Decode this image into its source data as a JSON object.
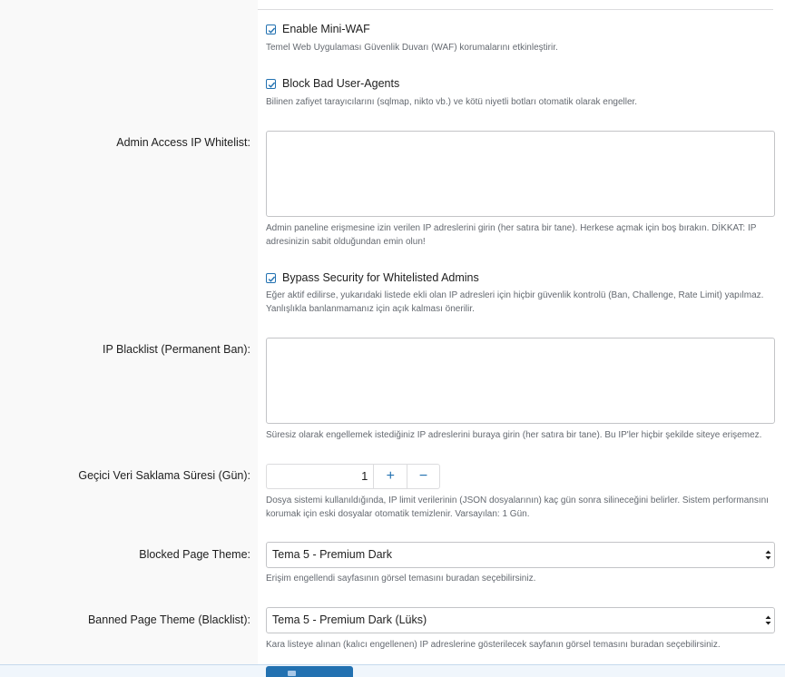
{
  "waf": {
    "label": "Enable Mini-WAF",
    "checked": true,
    "description": "Temel Web Uygulaması Güvenlik Duvarı (WAF) korumalarını etkinleştirir."
  },
  "bad_agents": {
    "label": "Block Bad User-Agents",
    "checked": true,
    "description": "Bilinen zafiyet tarayıcılarını (sqlmap, nikto vb.) ve kötü niyetli botları otomatik olarak engeller."
  },
  "whitelist": {
    "label": "Admin Access IP Whitelist:",
    "value": "",
    "description": "Admin paneline erişmesine izin verilen IP adreslerini girin (her satıra bir tane). Herkese açmak için boş bırakın. DİKKAT: IP adresinizin sabit olduğundan emin olun!"
  },
  "bypass": {
    "label": "Bypass Security for Whitelisted Admins",
    "checked": true,
    "description": "Eğer aktif edilirse, yukarıdaki listede ekli olan IP adresleri için hiçbir güvenlik kontrolü (Ban, Challenge, Rate Limit) yapılmaz. Yanlışlıkla banlanmamanız için açık kalması önerilir."
  },
  "blacklist": {
    "label": "IP Blacklist (Permanent Ban):",
    "value": "",
    "description": "Süresiz olarak engellemek istediğiniz IP adreslerini buraya girin (her satıra bir tane). Bu IP'ler hiçbir şekilde siteye erişemez."
  },
  "retention": {
    "label": "Geçici Veri Saklama Süresi (Gün):",
    "value": "1",
    "plus": "+",
    "minus": "−",
    "description": "Dosya sistemi kullanıldığında, IP limit verilerinin (JSON dosyalarının) kaç gün sonra silineceğini belirler. Sistem performansını korumak için eski dosyalar otomatik temizlenir. Varsayılan: 1 Gün."
  },
  "blocked_theme": {
    "label": "Blocked Page Theme:",
    "selected": "Tema 5 - Premium Dark",
    "description": "Erişim engellendi sayfasının görsel temasını buradan seçebilirsiniz."
  },
  "banned_theme": {
    "label": "Banned Page Theme (Blacklist):",
    "selected": "Tema 5 - Premium Dark (Lüks)",
    "description": "Kara listeye alınan (kalıcı engellenen) IP adreslerine gösterilecek sayfanın görsel temasını buradan seçebilirsiniz."
  },
  "colors": {
    "accent": "#2271b1",
    "muted_text": "#646970",
    "border": "#c3c4c7"
  },
  "icons": {
    "checkbox": "check-icon",
    "select": "select-arrows-icon",
    "save": "save-icon"
  }
}
